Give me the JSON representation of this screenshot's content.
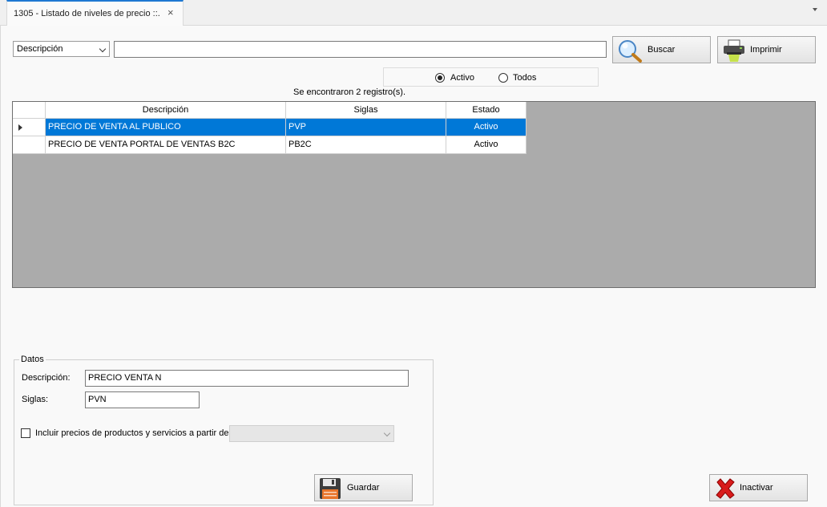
{
  "tab": {
    "title": "1305 - Listado de niveles de precio ::.",
    "close": "×"
  },
  "search": {
    "field_selected": "Descripción",
    "query_value": "",
    "search_label": "Buscar",
    "print_label": "Imprimir"
  },
  "filter": {
    "active_label": "Activo",
    "all_label": "Todos",
    "selected": "Activo"
  },
  "status": {
    "records_found": "Se encontraron 2 registro(s)."
  },
  "grid": {
    "columns": [
      "Descripción",
      "Siglas",
      "Estado"
    ],
    "rows": [
      {
        "descripcion": "PRECIO DE VENTA AL PUBLICO",
        "siglas": "PVP",
        "estado": "Activo",
        "selected": true
      },
      {
        "descripcion": "PRECIO DE VENTA PORTAL DE VENTAS B2C",
        "siglas": "PB2C",
        "estado": "Activo",
        "selected": false
      }
    ]
  },
  "datos": {
    "legend": "Datos",
    "descripcion_label": "Descripción:",
    "descripcion_value": "PRECIO VENTA N",
    "siglas_label": "Siglas:",
    "siglas_value": "PVN",
    "include_label": "Incluir precios de productos y servicios a partir de:",
    "include_checked": false,
    "include_source_value": ""
  },
  "actions": {
    "save_label": "Guardar",
    "deactivate_label": "Inactivar"
  },
  "colors": {
    "accent": "#0078d7",
    "grid_bg": "#ababab"
  }
}
